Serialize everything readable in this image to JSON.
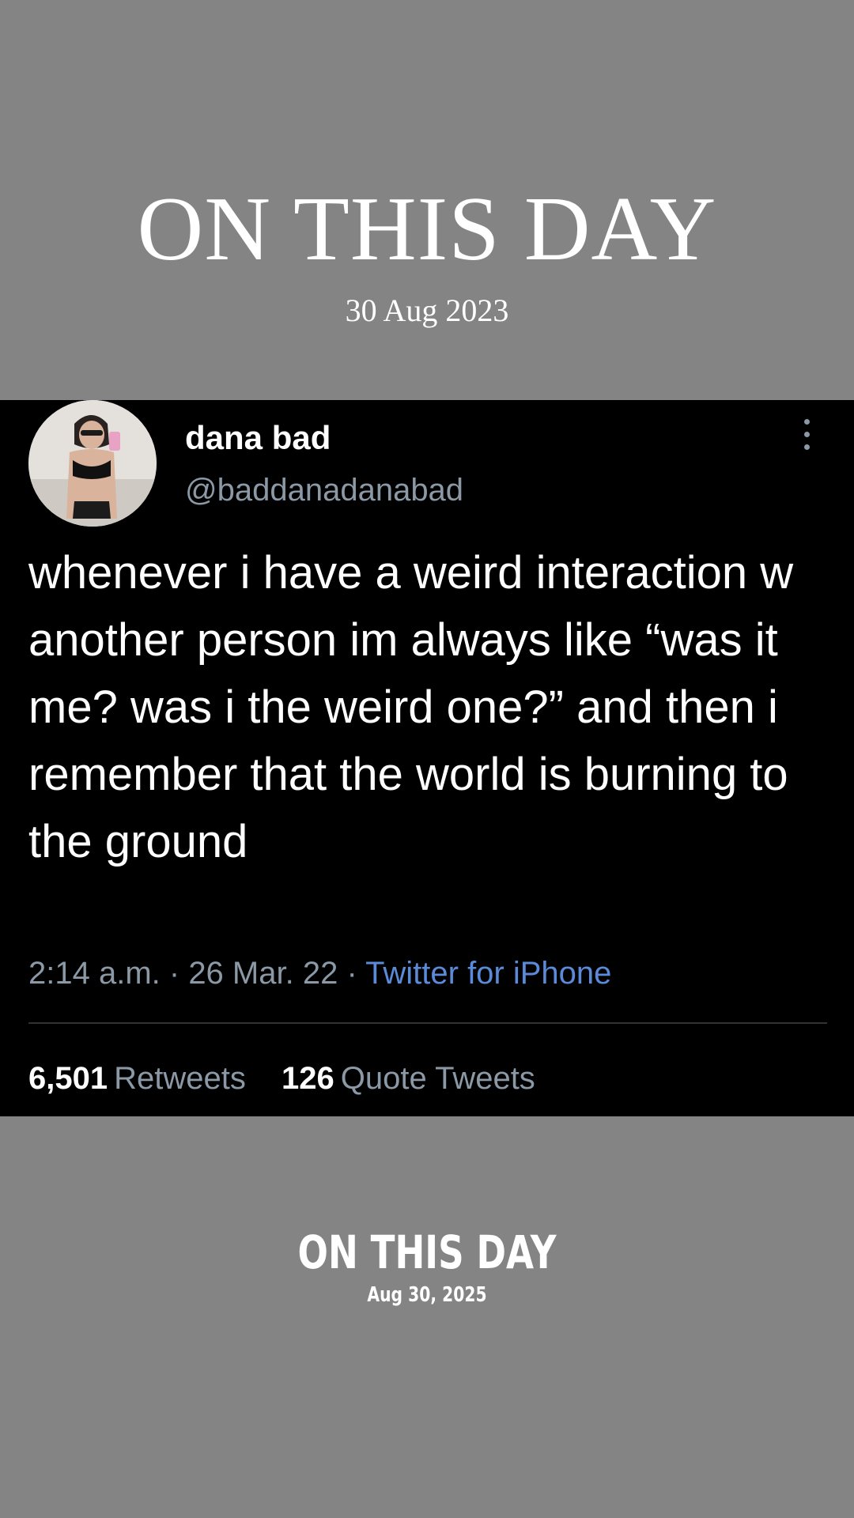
{
  "top_header": {
    "title": "ON THIS DAY",
    "date": "30 Aug 2023"
  },
  "tweet": {
    "display_name": "dana bad",
    "handle": "@baddanadanabad",
    "text": "whenever i have a weird interaction w another person im always like “was it me? was i the weird one?” and then i remember that the world is burning to the ground",
    "time": "2:14 a.m.",
    "date": "26 Mar. 22",
    "source": "Twitter for iPhone",
    "separator": " · ",
    "stats": {
      "retweets_count": "6,501",
      "retweets_label": "Retweets",
      "quote_count": "126",
      "quote_label": "Quote Tweets"
    },
    "icons": {
      "menu": "more-vertical-icon",
      "avatar": "avatar"
    },
    "colors": {
      "background": "#000000",
      "text": "#ffffff",
      "muted": "#8b98a5",
      "link": "#5b8ad8"
    }
  },
  "bottom_header": {
    "title": "ON THIS DAY",
    "date": "Aug 30, 2025"
  },
  "colors": {
    "page_background": "#848484"
  }
}
